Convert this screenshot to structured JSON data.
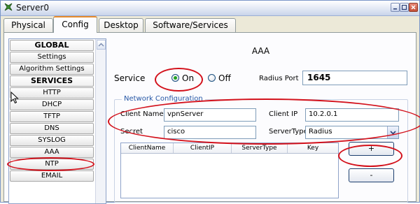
{
  "window": {
    "title": "Server0"
  },
  "tabs": [
    {
      "label": "Physical"
    },
    {
      "label": "Config",
      "active": true
    },
    {
      "label": "Desktop"
    },
    {
      "label": "Software/Services"
    }
  ],
  "sidebar": {
    "items": [
      {
        "label": "GLOBAL",
        "type": "header"
      },
      {
        "label": "Settings"
      },
      {
        "label": "Algorithm Settings"
      },
      {
        "label": "SERVICES",
        "type": "header"
      },
      {
        "label": "HTTP"
      },
      {
        "label": "DHCP"
      },
      {
        "label": "TFTP"
      },
      {
        "label": "DNS"
      },
      {
        "label": "SYSLOG"
      },
      {
        "label": "AAA",
        "selected": true
      },
      {
        "label": "NTP"
      },
      {
        "label": "EMAIL"
      }
    ]
  },
  "aaa": {
    "title": "AAA",
    "service_label": "Service",
    "service_on_label": "On",
    "service_off_label": "Off",
    "service_value": "On",
    "radius_port_label": "Radius Port",
    "radius_port_value": "1645"
  },
  "network_config": {
    "legend": "Network Configuration",
    "client_name_label": "Client Name",
    "client_name_value": "vpnServer",
    "client_ip_label": "Client IP",
    "client_ip_value": "10.2.0.1",
    "secret_label": "Secret",
    "secret_value": "cisco",
    "server_type_label": "ServerType",
    "server_type_value": "Radius"
  },
  "client_table": {
    "columns": [
      "ClientName",
      "ClientIP",
      "ServerType",
      "Key"
    ],
    "rows": []
  },
  "buttons": {
    "add_label": "+",
    "remove_label": "-"
  },
  "colors": {
    "annotation_red": "#d3111b",
    "tab_accent": "#e68b2c",
    "radio_selected": "#21a121",
    "legend_blue": "#2556a5"
  }
}
